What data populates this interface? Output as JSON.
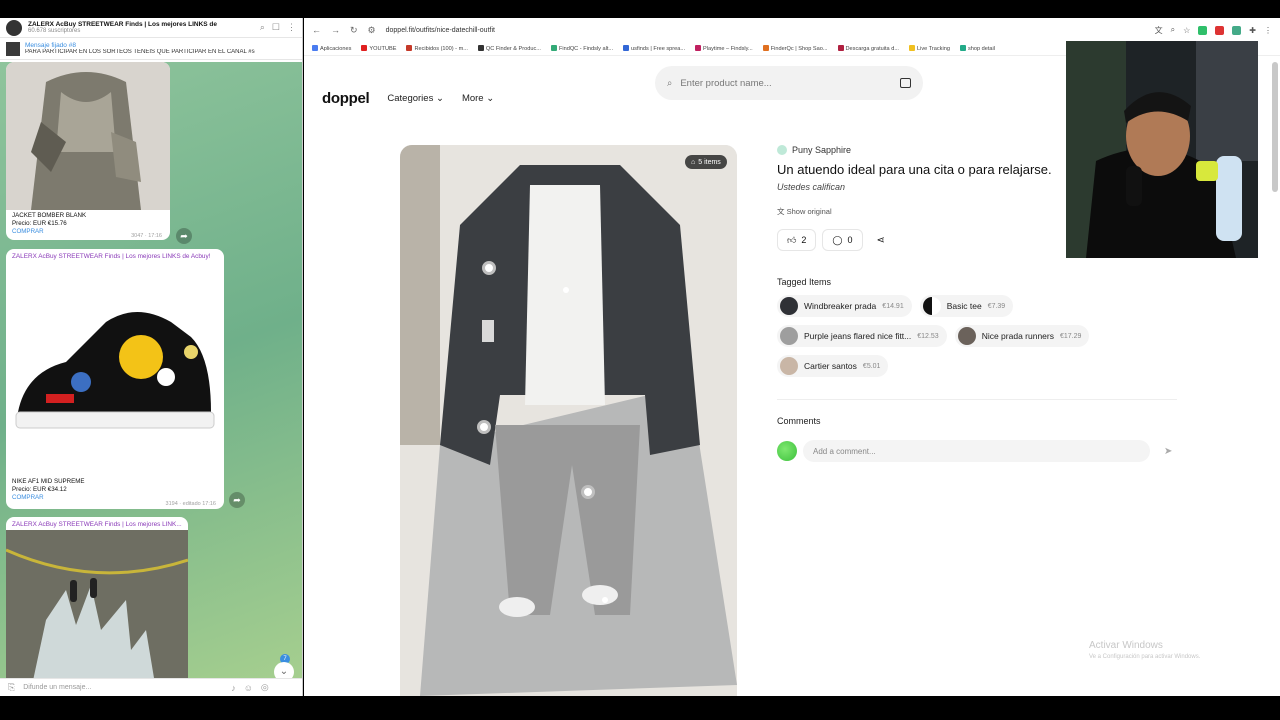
{
  "telegram": {
    "channel_title": "ZALERX AcBuy STREETWEAR Finds | Los mejores LINKS de AcBuy",
    "subscribers": "60.678 suscriptores",
    "pinned_label": "Mensaje fijado #8",
    "pinned_text": "PARA PARTICIPAR EN LOS SORTEOS TENÉIS QUE PARTICIPAR EN EL CANAL #sor...",
    "messages": [
      {
        "title": "JACKET BOMBER BLANK",
        "price": "Precio: EUR €15.76",
        "link": "COMPRAR",
        "meta": "3047 · 17:16"
      },
      {
        "header": "ZALERX AcBuy STREETWEAR Finds | Los mejores LINKS de Acbuy!",
        "title": "NIKE AF1 MID SUPREME",
        "price": "Precio: EUR €34.12",
        "link": "COMPRAR",
        "meta": "3194 · editado 17:16"
      },
      {
        "header": "ZALERX AcBuy STREETWEAR Finds | Los mejores LINK..."
      }
    ],
    "composer_placeholder": "Difunde un mensaje...",
    "unread": "7"
  },
  "browser": {
    "url": "doppel.fit/outfits/nice-datechill-outfit",
    "bookmarks": [
      "Aplicaciones",
      "YOUTUBE",
      "Recibidos (100) - m...",
      "QC Finder & Produc...",
      "FindQC - Findsly alt...",
      "usfinds | Free sprea...",
      "Playtime – Findsly...",
      "FinderQc | Shop Sao...",
      "Descarga gratuita d...",
      "Live Tracking",
      "shop detail"
    ]
  },
  "doppel": {
    "logo": "doppel",
    "nav": [
      "Categories",
      "More"
    ],
    "search_placeholder": "Enter product name...",
    "items_count": "5 items",
    "username": "Puny Sapphire",
    "outfit_title": "Un atuendo ideal para una cita o para relajarse.",
    "subtitle": "Ustedes califican",
    "show_original": "Show original",
    "likes": "2",
    "comments_count": "0",
    "tagged_heading": "Tagged Items",
    "tags": [
      {
        "name": "Windbreaker prada",
        "price": "€14.91"
      },
      {
        "name": "Basic tee",
        "price": "€7.39"
      },
      {
        "name": "Purple jeans flared nice fitt...",
        "price": "€12.53"
      },
      {
        "name": "Nice prada runners",
        "price": "€17.29"
      },
      {
        "name": "Cartier santos",
        "price": "€5.01"
      }
    ],
    "comments_heading": "Comments",
    "comment_placeholder": "Add a comment..."
  },
  "windows_watermark": {
    "line1": "Activar Windows",
    "line2": "Ve a Configuración para activar Windows."
  }
}
